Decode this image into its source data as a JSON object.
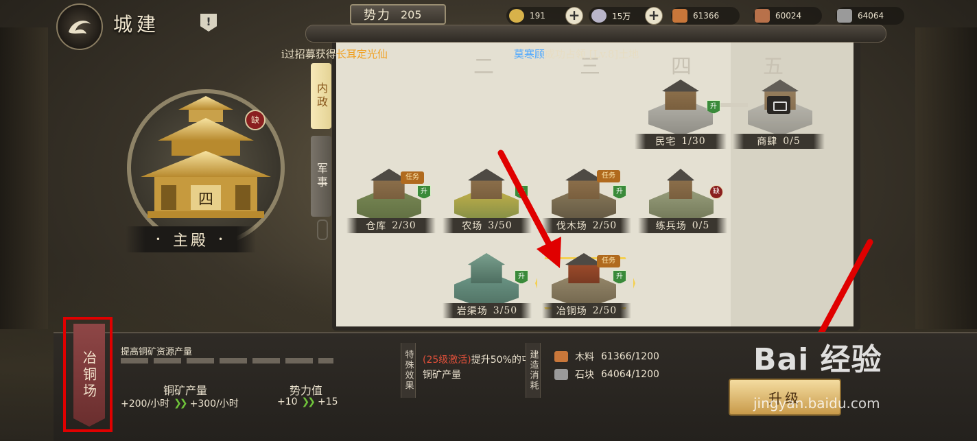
{
  "header": {
    "title": "城建",
    "info_icon": "!"
  },
  "power": {
    "label": "势力",
    "value": "205"
  },
  "resources": [
    {
      "name": "gold-coin",
      "value": "191",
      "plus": true,
      "color": "#d8b24a"
    },
    {
      "name": "silver-coin",
      "value": "15万",
      "plus": true,
      "color": "#b9b5c9"
    },
    {
      "name": "wood",
      "value": "61366",
      "plus": false,
      "color": "#c9773a"
    },
    {
      "name": "copper",
      "value": "60024",
      "plus": false,
      "color": "#b8714a"
    },
    {
      "name": "stone",
      "value": "64064",
      "plus": false,
      "color": "#9a9a9a"
    }
  ],
  "main_building": {
    "label": "主殿",
    "level_glyph": "四",
    "badge": "缺"
  },
  "tabs": [
    {
      "label": "内政",
      "active": true
    },
    {
      "label": "军事",
      "active": false
    }
  ],
  "ticker": {
    "prefix": "i过招募获得",
    "highlight1": "长耳定光仙",
    "name2": "莫寒顾",
    "suffix": "成功占领 [Lv.8]土地"
  },
  "tiers": [
    "二",
    "三",
    "四",
    "五"
  ],
  "buildings": [
    {
      "id": "minzhai",
      "name": "民宅",
      "count": "1/30",
      "badges": [
        "升"
      ]
    },
    {
      "id": "shangsi",
      "name": "商肆",
      "count": "0/5",
      "badges": []
    },
    {
      "id": "cangku",
      "name": "仓库",
      "count": "2/30",
      "badges": [
        "任务",
        "升"
      ]
    },
    {
      "id": "nongchang",
      "name": "农场",
      "count": "3/50",
      "badges": [
        "升"
      ]
    },
    {
      "id": "famuchang",
      "name": "伐木场",
      "count": "2/50",
      "badges": [
        "任务",
        "升"
      ]
    },
    {
      "id": "lianbingchang",
      "name": "练兵场",
      "count": "0/5",
      "badges": [
        "缺"
      ]
    },
    {
      "id": "yanqu",
      "name": "岩渠场",
      "count": "3/50",
      "badges": [
        "升"
      ]
    },
    {
      "id": "yetong",
      "name": "冶铜场",
      "count": "2/50",
      "badges": [
        "任务",
        "升"
      ],
      "selected": true
    }
  ],
  "detail": {
    "name": "冶铜场",
    "description": "提高铜矿资源产量",
    "stats": [
      {
        "label": "铜矿产量",
        "from": "+200/小时",
        "to": "+300/小时"
      },
      {
        "label": "势力值",
        "from": "+10",
        "to": "+15"
      }
    ],
    "special_tag": "特殊效果",
    "special_red": "(25级激活)",
    "special_text": "提升50%的屯田铜矿产量",
    "cost_tag": "建造消耗",
    "costs": [
      {
        "label": "木料",
        "value": "61366/1200",
        "color": "#c9773a"
      },
      {
        "label": "石块",
        "value": "64064/1200",
        "color": "#9a9a9a"
      }
    ],
    "upgrade_label": "升级"
  },
  "watermark": {
    "brand": "Bai 经验",
    "url": "jingyan.baidu.com"
  }
}
